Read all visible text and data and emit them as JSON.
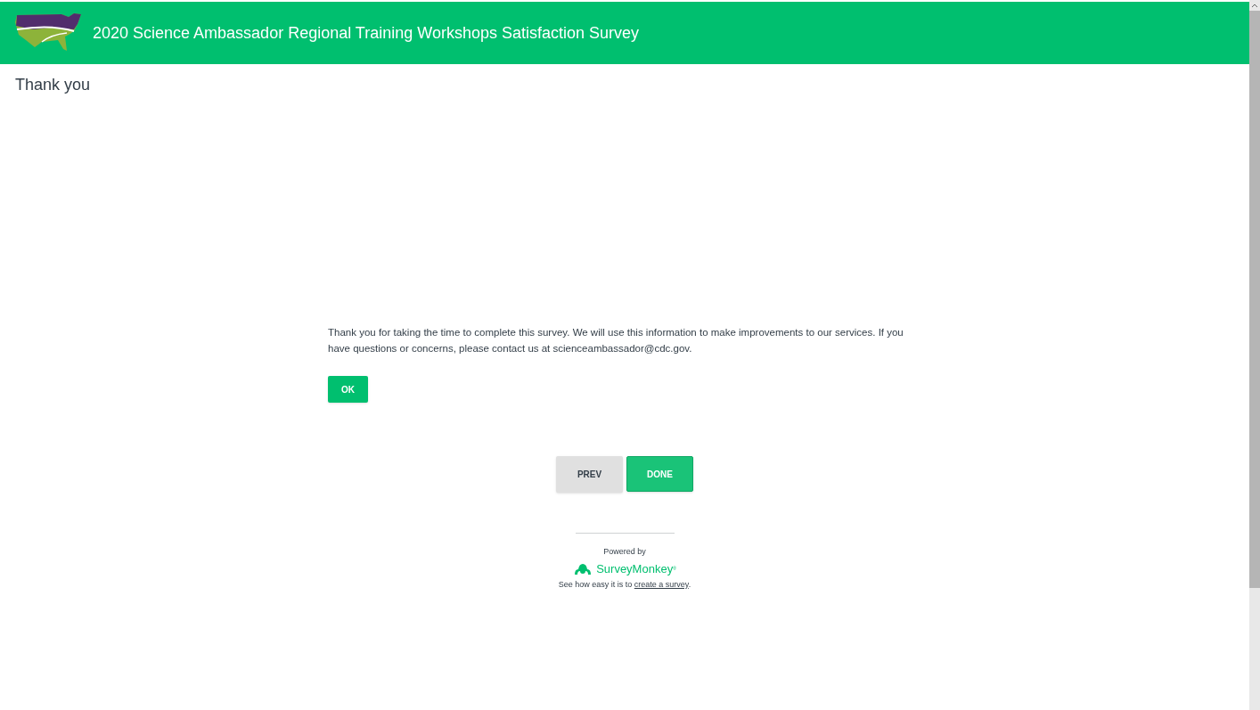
{
  "header": {
    "title": "2020 Science Ambassador Regional Training Workshops Satisfaction Survey"
  },
  "page_title": "Thank you",
  "message": "Thank you for taking the time to complete this survey. We will use this information to make improvements to our services. If you have questions or concerns, please contact us at scienceambassador@cdc.gov.",
  "ok_button": "OK",
  "nav_buttons": [
    {
      "label": "PREV",
      "kind": "secondary"
    },
    {
      "label": "DONE",
      "kind": "primary"
    }
  ],
  "footer": {
    "powered_by": "Powered by",
    "brand": "SurveyMonkey",
    "brand_mark": "®",
    "text_before": "See how easy it is to ",
    "link": "create a survey",
    "text_after": "."
  }
}
